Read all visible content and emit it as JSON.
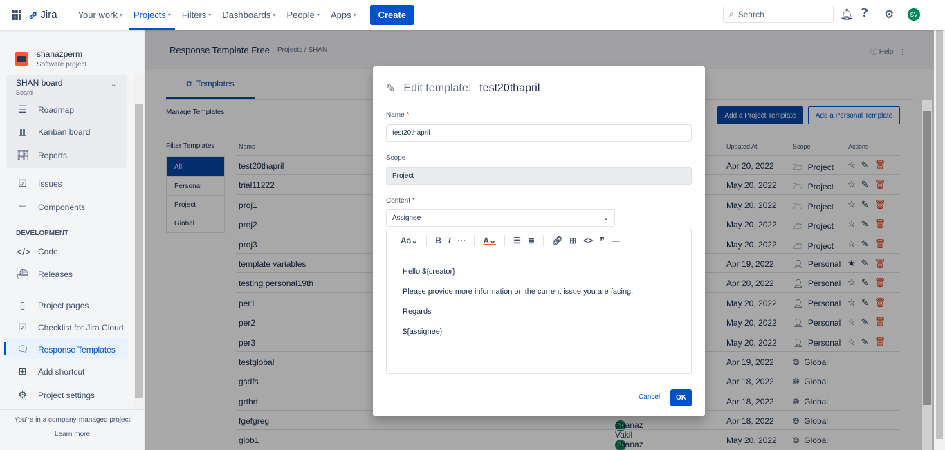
{
  "topnav": {
    "logo": "Jira",
    "items": [
      {
        "label": "Your work"
      },
      {
        "label": "Projects",
        "active": true
      },
      {
        "label": "Filters"
      },
      {
        "label": "Dashboards"
      },
      {
        "label": "People"
      },
      {
        "label": "Apps"
      }
    ],
    "create": "Create",
    "search_placeholder": "Search",
    "avatar": "SV"
  },
  "sidebar": {
    "project_name": "shanazperm",
    "project_type": "Software project",
    "board_name": "SHAN board",
    "board_sub": "Board",
    "board_items": [
      "Roadmap",
      "Kanban board",
      "Reports"
    ],
    "items": [
      "Issues",
      "Components"
    ],
    "section": "DEVELOPMENT",
    "dev_items": [
      "Code",
      "Releases"
    ],
    "app_items": [
      "Project pages",
      "Checklist for Jira Cloud",
      "Response Templates",
      "Add shortcut",
      "Project settings"
    ],
    "footer": "You're in a company-managed project",
    "learn_more": "Learn more"
  },
  "main": {
    "title": "Response Template Free",
    "breadcrumb": "Projects / SHAN",
    "help": "Help",
    "tab": "Templates",
    "manage": "Manage Templates",
    "add_project": "Add a Project Template",
    "add_personal": "Add a Personal Template",
    "filter_title": "Filter Templates",
    "filters": [
      "All",
      "Personal",
      "Project",
      "Global"
    ],
    "columns": {
      "name": "Name",
      "updated": "Updated At",
      "scope": "Scope",
      "actions": "Actions"
    },
    "rows": [
      {
        "name": "test20thapril",
        "creator": "",
        "updated": "Apr 20, 2022",
        "scope": "Project",
        "starred": false,
        "actions": true
      },
      {
        "name": "trial11222",
        "creator": "",
        "updated": "May 20, 2022",
        "scope": "Project",
        "starred": false,
        "actions": true
      },
      {
        "name": "proj1",
        "creator": "",
        "updated": "May 20, 2022",
        "scope": "Project",
        "starred": false,
        "actions": true
      },
      {
        "name": "proj2",
        "creator": "",
        "updated": "May 20, 2022",
        "scope": "Project",
        "starred": false,
        "actions": true
      },
      {
        "name": "proj3",
        "creator": "",
        "updated": "May 20, 2022",
        "scope": "Project",
        "starred": false,
        "actions": true
      },
      {
        "name": "template variables",
        "creator": "",
        "updated": "Apr 19, 2022",
        "scope": "Personal",
        "starred": true,
        "actions": true
      },
      {
        "name": "testing personal19th",
        "creator": "",
        "updated": "Apr 20, 2022",
        "scope": "Personal",
        "starred": false,
        "actions": true
      },
      {
        "name": "per1",
        "creator": "",
        "updated": "May 20, 2022",
        "scope": "Personal",
        "starred": false,
        "actions": true
      },
      {
        "name": "per2",
        "creator": "",
        "updated": "May 20, 2022",
        "scope": "Personal",
        "starred": false,
        "actions": true
      },
      {
        "name": "per3",
        "creator": "",
        "updated": "May 20, 2022",
        "scope": "Personal",
        "starred": false,
        "actions": true
      },
      {
        "name": "testglobal",
        "creator": "",
        "updated": "Apr 19, 2022",
        "scope": "Global",
        "starred": false,
        "actions": false
      },
      {
        "name": "gsdfs",
        "creator": "",
        "updated": "Apr 18, 2022",
        "scope": "Global",
        "starred": false,
        "actions": false
      },
      {
        "name": "grthrt",
        "creator": "",
        "updated": "Apr 18, 2022",
        "scope": "Global",
        "starred": false,
        "actions": false
      },
      {
        "name": "fgefgreg",
        "creator": "Shanaz Vakil",
        "updated": "Apr 18, 2022",
        "scope": "Global",
        "starred": false,
        "actions": false
      },
      {
        "name": "glob1",
        "creator": "Shanaz Vakil",
        "updated": "May 20, 2022",
        "scope": "Global",
        "starred": false,
        "actions": false
      }
    ]
  },
  "modal": {
    "title_prefix": "Edit template:",
    "title_name": "test20thapril",
    "name_label": "Name",
    "name_value": "test20thapril",
    "scope_label": "Scope",
    "scope_value": "Project",
    "content_label": "Content",
    "variable_select": "Assignee",
    "content": [
      "Hello ${creator}",
      "Please provide more information on the current issue you are facing.",
      "Regards",
      "${assignee}"
    ],
    "cancel": "Cancel",
    "ok": "OK"
  },
  "colors": {
    "brand": "#0052cc",
    "delete": "#de350b",
    "avatar": "#00875a"
  }
}
